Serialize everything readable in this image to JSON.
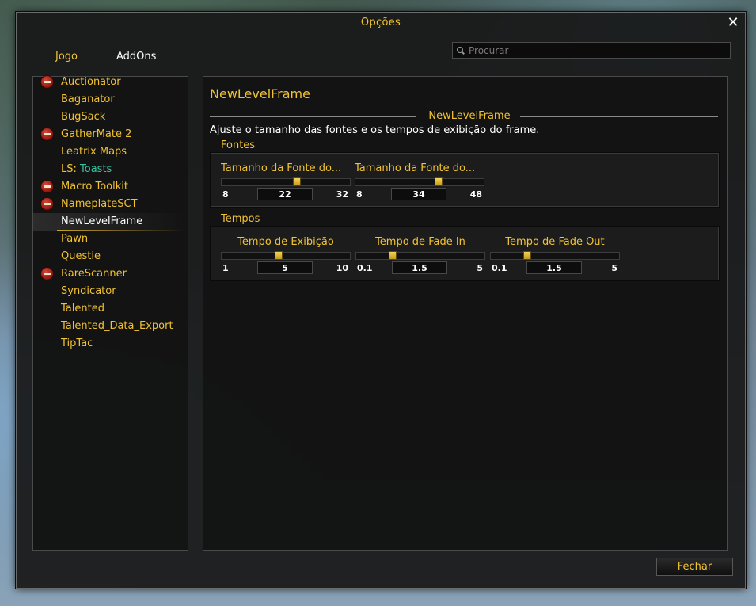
{
  "window": {
    "title": "Opções",
    "close_glyph": "✕"
  },
  "tabs": [
    {
      "label": "Jogo",
      "active": false
    },
    {
      "label": "AddOns",
      "active": true
    }
  ],
  "search": {
    "placeholder": "Procurar"
  },
  "sidebar": {
    "items": [
      {
        "label": "Auctionator",
        "collapsible": true
      },
      {
        "label": "Baganator",
        "collapsible": false
      },
      {
        "label": "BugSack",
        "collapsible": false
      },
      {
        "label": "GatherMate 2",
        "collapsible": true
      },
      {
        "label": "Leatrix Maps",
        "collapsible": false
      },
      {
        "label_prefix": "LS: ",
        "label_suffix": "Toasts",
        "collapsible": false
      },
      {
        "label": "Macro Toolkit",
        "collapsible": true
      },
      {
        "label": "NameplateSCT",
        "collapsible": true
      },
      {
        "label": "NewLevelFrame",
        "collapsible": false,
        "selected": true
      },
      {
        "label": "Pawn",
        "collapsible": false
      },
      {
        "label": "Questie",
        "collapsible": false
      },
      {
        "label": "RareScanner",
        "collapsible": true
      },
      {
        "label": "Syndicator",
        "collapsible": false
      },
      {
        "label": "Talented",
        "collapsible": false
      },
      {
        "label": "Talented_Data_Export",
        "collapsible": false
      },
      {
        "label": "TipTac",
        "collapsible": false
      }
    ]
  },
  "content": {
    "title": "NewLevelFrame",
    "section_title": "NewLevelFrame",
    "description": "Ajuste o tamanho das fontes e os tempos de exibição do frame.",
    "fontes": {
      "label": "Fontes",
      "sliders": [
        {
          "label": "Tamanho da Fonte do...",
          "min": "8",
          "max": "32",
          "value": "22",
          "min_num": 8,
          "max_num": 32,
          "value_num": 22
        },
        {
          "label": "Tamanho da Fonte do...",
          "min": "8",
          "max": "48",
          "value": "34",
          "min_num": 8,
          "max_num": 48,
          "value_num": 34
        }
      ]
    },
    "tempos": {
      "label": "Tempos",
      "sliders": [
        {
          "label": "Tempo de Exibição",
          "min": "1",
          "max": "10",
          "value": "5",
          "min_num": 1,
          "max_num": 10,
          "value_num": 5
        },
        {
          "label": "Tempo de Fade In",
          "min": "0.1",
          "max": "5",
          "value": "1.5",
          "min_num": 0.1,
          "max_num": 5,
          "value_num": 1.5
        },
        {
          "label": "Tempo de Fade Out",
          "min": "0.1",
          "max": "5",
          "value": "1.5",
          "min_num": 0.1,
          "max_num": 5,
          "value_num": 1.5
        }
      ]
    }
  },
  "footer": {
    "close_label": "Fechar"
  },
  "colors": {
    "gold": "#f1c232",
    "teal": "#37c4a3",
    "white": "#ffffff"
  }
}
